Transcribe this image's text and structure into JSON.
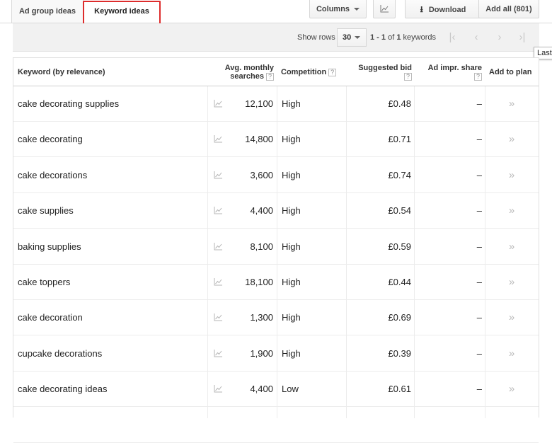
{
  "tabs": {
    "ad_group_ideas": "Ad group ideas",
    "keyword_ideas": "Keyword ideas"
  },
  "toolbar": {
    "columns_label": "Columns",
    "download_label": "Download",
    "add_all_label": "Add all (801)"
  },
  "pager": {
    "show_rows_label": "Show rows",
    "rows_value": "30",
    "range_prefix": "1 - 1",
    "range_of": "of",
    "range_total": "1",
    "range_suffix": "keywords",
    "tooltip": "Last"
  },
  "table": {
    "headers": {
      "keyword": "Keyword (by relevance)",
      "searches_line1": "Avg. monthly",
      "searches_line2": "searches",
      "competition": "Competition",
      "bid": "Suggested bid",
      "impr": "Ad impr. share",
      "plan": "Add to plan",
      "help": "?"
    },
    "rows": [
      {
        "keyword": "cake decorating supplies",
        "searches": "12,100",
        "competition": "High",
        "bid": "£0.48",
        "impr": "–",
        "plan": "»"
      },
      {
        "keyword": "cake decorating",
        "searches": "14,800",
        "competition": "High",
        "bid": "£0.71",
        "impr": "–",
        "plan": "»"
      },
      {
        "keyword": "cake decorations",
        "searches": "3,600",
        "competition": "High",
        "bid": "£0.74",
        "impr": "–",
        "plan": "»"
      },
      {
        "keyword": "cake supplies",
        "searches": "4,400",
        "competition": "High",
        "bid": "£0.54",
        "impr": "–",
        "plan": "»"
      },
      {
        "keyword": "baking supplies",
        "searches": "8,100",
        "competition": "High",
        "bid": "£0.59",
        "impr": "–",
        "plan": "»"
      },
      {
        "keyword": "cake toppers",
        "searches": "18,100",
        "competition": "High",
        "bid": "£0.44",
        "impr": "–",
        "plan": "»"
      },
      {
        "keyword": "cake decoration",
        "searches": "1,300",
        "competition": "High",
        "bid": "£0.69",
        "impr": "–",
        "plan": "»"
      },
      {
        "keyword": "cupcake decorations",
        "searches": "1,900",
        "competition": "High",
        "bid": "£0.39",
        "impr": "–",
        "plan": "»"
      },
      {
        "keyword": "cake decorating ideas",
        "searches": "4,400",
        "competition": "Low",
        "bid": "£0.61",
        "impr": "–",
        "plan": "»"
      }
    ]
  },
  "icons": {
    "trend": "trend-chart-icon",
    "download": "download-icon",
    "first": "first-page-icon",
    "prev": "prev-page-icon",
    "next": "next-page-icon",
    "last": "last-page-icon"
  },
  "colors": {
    "highlight": "#dd2c2c",
    "disabled": "#c8c8c8"
  }
}
